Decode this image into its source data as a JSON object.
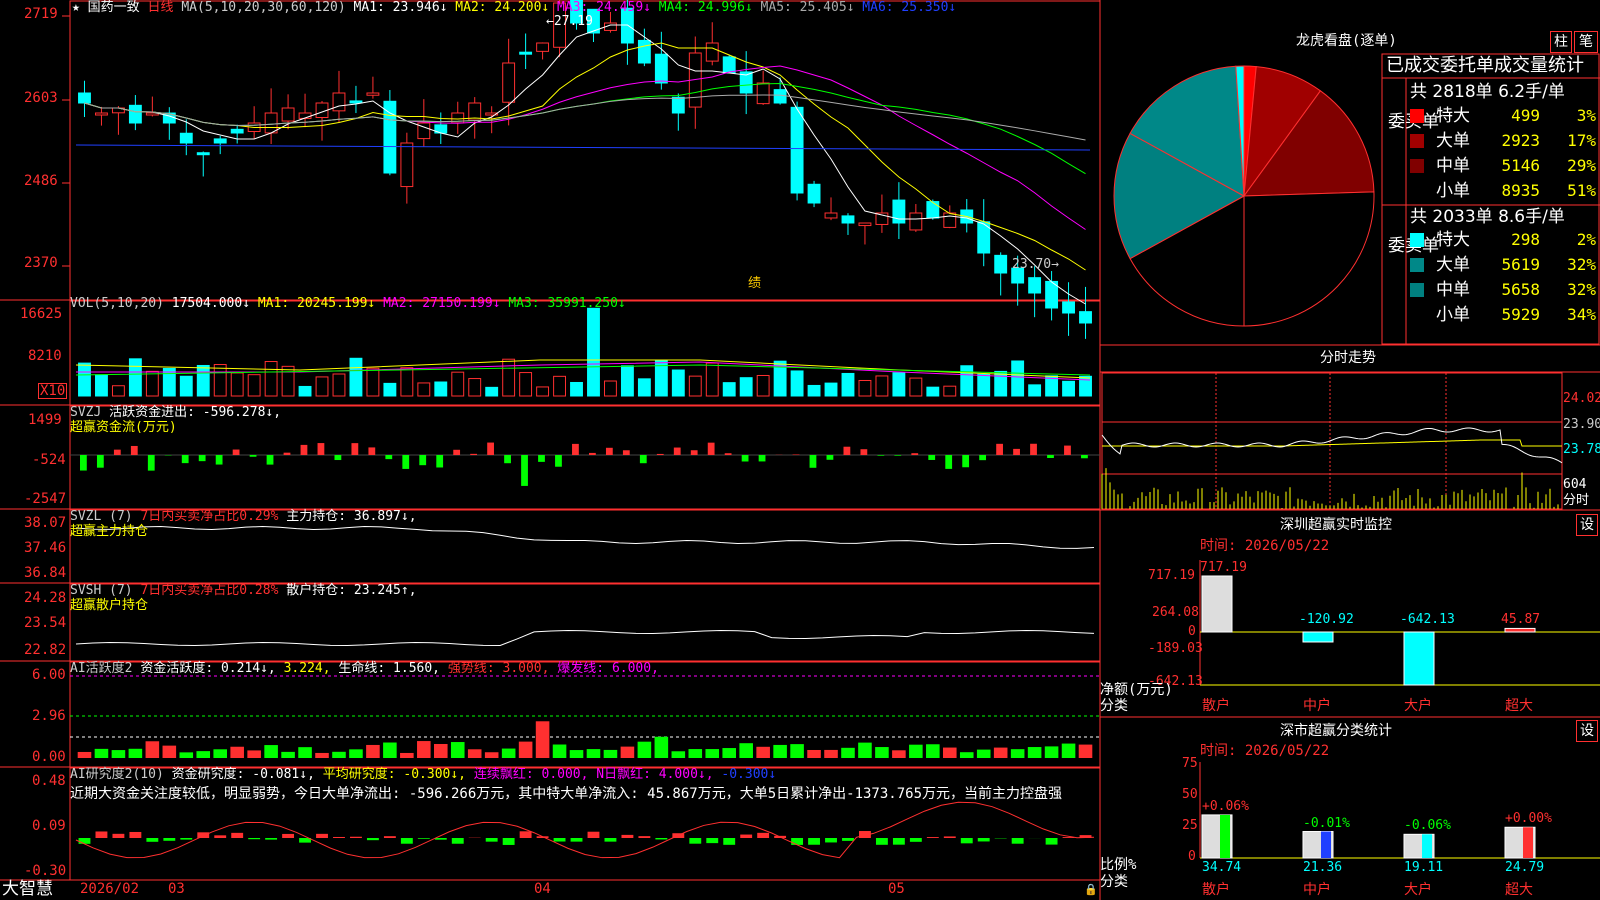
{
  "stock": {
    "name": "国药一致",
    "period": "日线",
    "star": "★"
  },
  "indicators": {
    "ma": {
      "params": "MA(5,10,20,30,60,120)",
      "ma1": "MA1: 23.946↓",
      "ma2": "MA2: 24.200↓",
      "ma3": "MA3: 24.459↓",
      "ma4": "MA4: 24.996↓",
      "ma5": "MA5: 25.405↓",
      "ma6": "MA6: 25.350↓"
    },
    "vol": {
      "params": "VOL(5,10,20)",
      "value": "17504.000↓",
      "ma1": "MA1: 20245.199↓",
      "ma2": "MA2: 27150.199↓",
      "ma3": "MA3: 35991.250↓"
    },
    "svzj": {
      "params": "SVZJ",
      "text": "活跃资金进出: -596.278↓,",
      "sub": "超赢资金流(万元)"
    },
    "svzl": {
      "params": "SVZL (7)",
      "text1": "7日内买卖净占比0.29%",
      "text2": "主力持仓: 36.897↓,",
      "sub": "超赢主力持仓"
    },
    "svsh": {
      "params": "SVSH (7)",
      "text1": "7日内买卖净占比0.28%",
      "text2": "散户持仓: 23.245↑,",
      "sub": "超赢散户持仓"
    },
    "aihy": {
      "params": "AI活跃度2",
      "t1": "资金活跃度: 0.214↓,",
      "t2": "3.224,",
      "t3": "生命线: 1.560,",
      "t4": "强势线: 3.000,",
      "t5": "爆发线: 6.000,"
    },
    "aiyj": {
      "params": "AI研究度2(10)",
      "t1": "资金研究度: -0.081↓,",
      "t2": "平均研究度: -0.300↓,",
      "t3": "连续飘红: 0.000,",
      "t4": "N日飘红: 4.000↓,",
      "t5": "-0.300↓",
      "analysis": "近期大资金关注度较低，明显弱势，今日大单净流出: -596.266万元，其中特大单净流入: 45.867万元，大单5日累计净出-1373.765万元，当前主力控盘强"
    }
  },
  "price_axis": [
    "2719",
    "2603",
    "2486",
    "2370"
  ],
  "vol_axis": [
    "16625",
    "8210",
    "X10"
  ],
  "svzj_axis": [
    "1499",
    "-524",
    "-2547"
  ],
  "svzl_axis": [
    "38.07",
    "37.46",
    "36.84"
  ],
  "svsh_axis": [
    "24.28",
    "23.54",
    "22.82"
  ],
  "aihy_axis": [
    "6.00",
    "2.96",
    "0.00"
  ],
  "aiyj_axis": [
    "0.48",
    "0.09",
    "-0.30"
  ],
  "annotations": {
    "high": "27.19",
    "low": "23.70",
    "marker": "绩"
  },
  "bottom_bar": {
    "brand": "大智慧",
    "dates": [
      "2026/02",
      "03",
      "04",
      "05"
    ]
  },
  "longhu": {
    "title": "龙虎看盘(逐单)",
    "btn1": "柱",
    "btn2": "笔",
    "header": "已成交委托单成交量统计",
    "buy": {
      "label": "委买单",
      "total": "共 2818单 6.2手/单",
      "rows": [
        {
          "name": "特大",
          "count": "499",
          "pct": "3%",
          "color": "#ff0000"
        },
        {
          "name": "大单",
          "count": "2923",
          "pct": "17%",
          "color": "#a00000"
        },
        {
          "name": "中单",
          "count": "5146",
          "pct": "29%",
          "color": "#800000"
        },
        {
          "name": "小单",
          "count": "8935",
          "pct": "51%",
          "color": "#000000"
        }
      ]
    },
    "sell": {
      "label": "委卖单",
      "total": "共 2033单 8.6手/单",
      "rows": [
        {
          "name": "特大",
          "count": "298",
          "pct": "2%",
          "color": "#00ffff"
        },
        {
          "name": "大单",
          "count": "5619",
          "pct": "32%",
          "color": "#008888"
        },
        {
          "name": "中单",
          "count": "5658",
          "pct": "32%",
          "color": "#008080"
        },
        {
          "name": "小单",
          "count": "5929",
          "pct": "34%",
          "color": "#000000"
        }
      ]
    }
  },
  "fenshi": {
    "title": "分时走势",
    "axis": [
      "24.02",
      "23.90",
      "23.78"
    ],
    "vol_label": "604",
    "vol_unit": "分时"
  },
  "monitor": {
    "title": "深圳超赢实时监控",
    "btn": "设",
    "time": "时间: 2026/05/22",
    "axis": [
      "717.19",
      "264.08",
      "0",
      "-189.03",
      "-642.13"
    ],
    "ylabel1": "净额(万元)",
    "ylabel2": "分类",
    "cats": [
      "散户",
      "中户",
      "大户",
      "超大"
    ],
    "values": [
      717.19,
      -120.92,
      -642.13,
      45.87
    ],
    "labels": [
      "717.19",
      "-120.92",
      "-642.13",
      "45.87"
    ]
  },
  "classify": {
    "title": "深市超赢分类统计",
    "btn": "设",
    "time": "时间: 2026/05/22",
    "axis": [
      "75",
      "50",
      "25",
      "0"
    ],
    "ylabel1": "比例%",
    "ylabel2": "分类",
    "cats": [
      "散户",
      "中户",
      "大户",
      "超大"
    ],
    "values": [
      34.74,
      21.36,
      19.11,
      24.79
    ],
    "vlabels": [
      "34.74",
      "21.36",
      "19.11",
      "24.79"
    ],
    "changes": [
      "+0.06%",
      "-0.01%",
      "-0.06%",
      "+0.00%"
    ]
  }
}
